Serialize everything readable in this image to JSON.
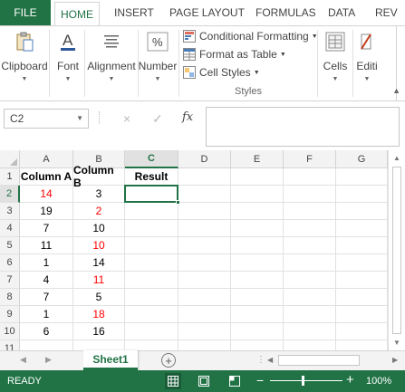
{
  "tabs": {
    "file": "FILE",
    "items": [
      "HOME",
      "INSERT",
      "PAGE LAYOUT",
      "FORMULAS",
      "DATA",
      "REV"
    ],
    "active": "HOME"
  },
  "ribbon": {
    "clipboard": "Clipboard",
    "font": "Font",
    "alignment": "Alignment",
    "number": "Number",
    "conditional_formatting": "Conditional Formatting",
    "format_as_table": "Format as Table",
    "cell_styles": "Cell Styles",
    "styles_group": "Styles",
    "cells": "Cells",
    "editing": "Editi"
  },
  "formula_bar": {
    "name_box": "C2",
    "content": "",
    "cancel_icon": "×",
    "enter_icon": "✓",
    "fx": "fx"
  },
  "grid": {
    "columns": [
      "A",
      "B",
      "C",
      "D",
      "E",
      "F",
      "G"
    ],
    "selected_column": "C",
    "rows": [
      {
        "num": "1",
        "a": "Column A",
        "b": "Column B",
        "c": "Result"
      },
      {
        "num": "2",
        "a": "14",
        "b": "3",
        "c": ""
      },
      {
        "num": "3",
        "a": "19",
        "b": "2",
        "c": ""
      },
      {
        "num": "4",
        "a": "7",
        "b": "10",
        "c": ""
      },
      {
        "num": "5",
        "a": "11",
        "b": "10",
        "c": ""
      },
      {
        "num": "6",
        "a": "1",
        "b": "14",
        "c": ""
      },
      {
        "num": "7",
        "a": "4",
        "b": "11",
        "c": ""
      },
      {
        "num": "8",
        "a": "7",
        "b": "5",
        "c": ""
      },
      {
        "num": "9",
        "a": "1",
        "b": "18",
        "c": ""
      },
      {
        "num": "10",
        "a": "6",
        "b": "16",
        "c": ""
      },
      {
        "num": "11",
        "a": "",
        "b": "",
        "c": ""
      }
    ],
    "selected_row": "2",
    "red_a": [
      "14",
      "7",
      "1",
      "7",
      "6"
    ],
    "red_b": [
      "2",
      "10",
      "11",
      "18"
    ]
  },
  "sheet_tabs": {
    "active": "Sheet1",
    "add": "+"
  },
  "status": {
    "ready": "READY",
    "zoom": "100%",
    "zoom_minus": "−",
    "zoom_plus": "+"
  },
  "colors": {
    "accent": "#217346",
    "red_text": "#ff0000",
    "black_text": "#000000"
  }
}
